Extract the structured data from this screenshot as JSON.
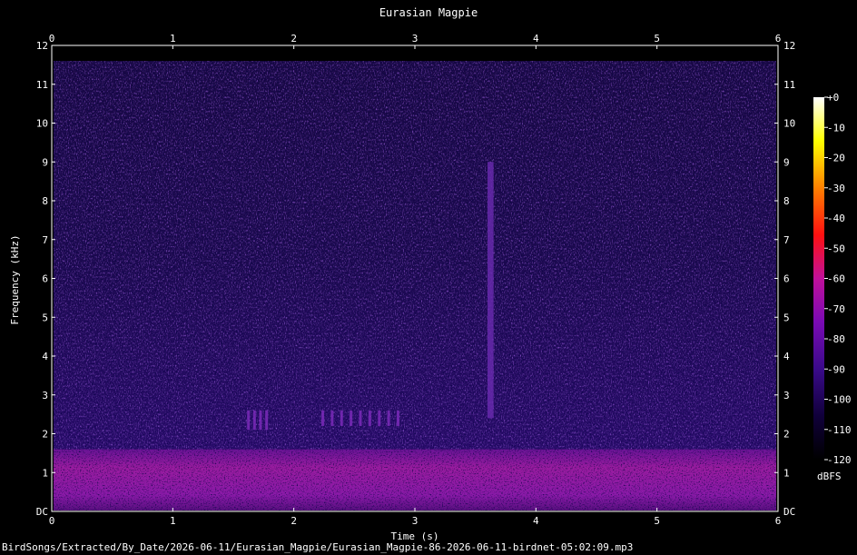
{
  "chart_data": {
    "type": "heatmap",
    "title": "Eurasian Magpie",
    "xlabel": "Time (s)",
    "ylabel": "Frequency (kHz)",
    "xlim": [
      0,
      6
    ],
    "ylim": [
      0,
      12
    ],
    "x_ticks": [
      "0",
      "1",
      "2",
      "3",
      "4",
      "5",
      "6"
    ],
    "y_ticks": [
      "DC",
      "1",
      "2",
      "3",
      "4",
      "5",
      "6",
      "7",
      "8",
      "9",
      "10",
      "11",
      "12"
    ],
    "colorbar": {
      "unit": "dBFS",
      "range": [
        -120,
        0
      ],
      "ticks": [
        "+0",
        "-10",
        "-20",
        "-30",
        "-40",
        "-50",
        "-60",
        "-70",
        "-80",
        "-90",
        "-100",
        "-110",
        "-120"
      ]
    },
    "file_path": "BirdSongs/Extracted/By_Date/2026-06-11/Eurasian_Magpie/Eurasian_Magpie-86-2026-06-11-birdnet-05:02:09.mp3",
    "features": [
      {
        "time_start": 0.0,
        "time_end": 6.0,
        "freq_low_khz": 0.0,
        "freq_high_khz": 1.6,
        "level_dbfs": -70
      },
      {
        "time_start": 1.6,
        "time_end": 1.8,
        "freq_low_khz": 2.1,
        "freq_high_khz": 2.6,
        "level_dbfs": -85
      },
      {
        "time_start": 2.2,
        "time_end": 2.9,
        "freq_low_khz": 2.2,
        "freq_high_khz": 2.6,
        "level_dbfs": -80
      },
      {
        "time_start": 3.6,
        "time_end": 3.65,
        "freq_low_khz": 2.4,
        "freq_high_khz": 9.0,
        "level_dbfs": -85
      }
    ],
    "background_level_dbfs": -100,
    "content_freq_max_khz": 11.6
  },
  "colors": {
    "background": "#000000",
    "text": "#ffffff",
    "colormap": [
      "#000000",
      "#10003a",
      "#3a0a8a",
      "#7a0ab4",
      "#c0109a",
      "#ff1010",
      "#ff8000",
      "#ffff00",
      "#ffffff"
    ]
  }
}
